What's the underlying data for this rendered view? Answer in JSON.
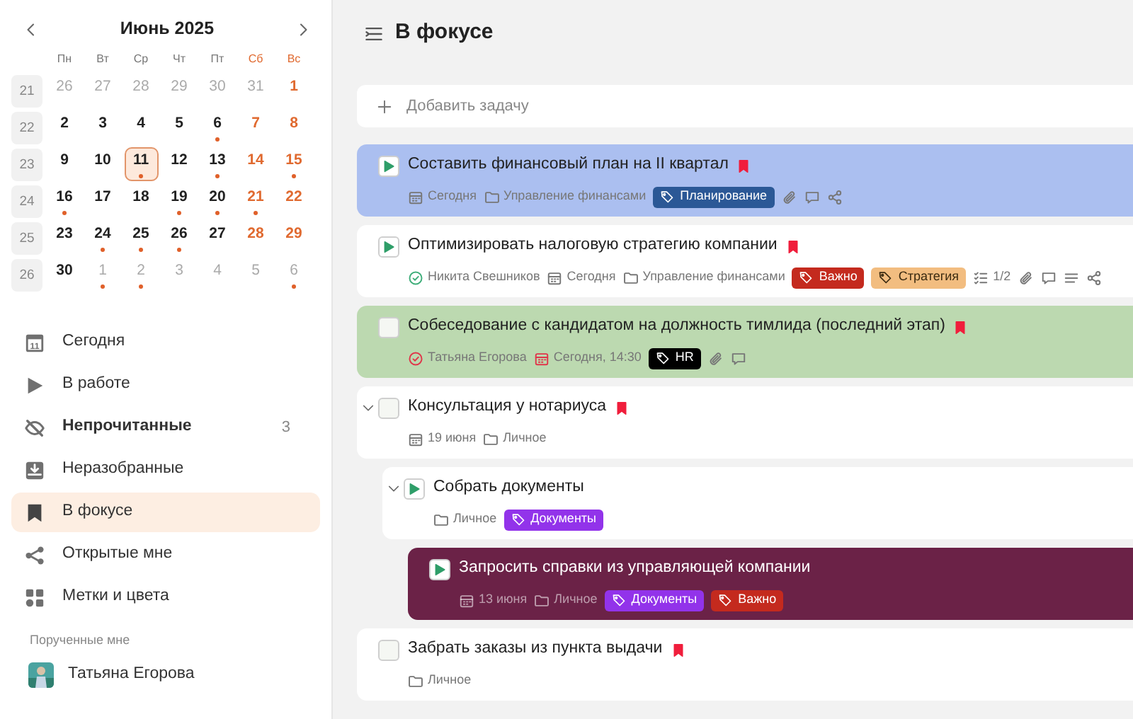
{
  "calendar": {
    "title": "Июнь 2025",
    "weekdays": [
      {
        "text": "Пн",
        "weekend": false
      },
      {
        "text": "Вт",
        "weekend": false
      },
      {
        "text": "Ср",
        "weekend": false
      },
      {
        "text": "Чт",
        "weekend": false
      },
      {
        "text": "Пт",
        "weekend": false
      },
      {
        "text": "Сб",
        "weekend": true
      },
      {
        "text": "Вс",
        "weekend": true
      }
    ],
    "weeks": [
      {
        "number": "21",
        "days": [
          {
            "text": "26",
            "kind": "other",
            "dot": false,
            "selected": false
          },
          {
            "text": "27",
            "kind": "other",
            "dot": false,
            "selected": false
          },
          {
            "text": "28",
            "kind": "other",
            "dot": false,
            "selected": false
          },
          {
            "text": "29",
            "kind": "other",
            "dot": false,
            "selected": false
          },
          {
            "text": "30",
            "kind": "other",
            "dot": false,
            "selected": false
          },
          {
            "text": "31",
            "kind": "other",
            "dot": false,
            "selected": false
          },
          {
            "text": "1",
            "kind": "weekend",
            "dot": false,
            "selected": false
          }
        ]
      },
      {
        "number": "22",
        "days": [
          {
            "text": "2",
            "kind": "day",
            "dot": false,
            "selected": false
          },
          {
            "text": "3",
            "kind": "day",
            "dot": false,
            "selected": false
          },
          {
            "text": "4",
            "kind": "day",
            "dot": false,
            "selected": false
          },
          {
            "text": "5",
            "kind": "day",
            "dot": false,
            "selected": false
          },
          {
            "text": "6",
            "kind": "day",
            "dot": true,
            "selected": false
          },
          {
            "text": "7",
            "kind": "weekend",
            "dot": false,
            "selected": false
          },
          {
            "text": "8",
            "kind": "weekend",
            "dot": false,
            "selected": false
          }
        ]
      },
      {
        "number": "23",
        "days": [
          {
            "text": "9",
            "kind": "day",
            "dot": false,
            "selected": false
          },
          {
            "text": "10",
            "kind": "day",
            "dot": false,
            "selected": false
          },
          {
            "text": "11",
            "kind": "day",
            "dot": true,
            "selected": true
          },
          {
            "text": "12",
            "kind": "day",
            "dot": false,
            "selected": false
          },
          {
            "text": "13",
            "kind": "day",
            "dot": true,
            "selected": false
          },
          {
            "text": "14",
            "kind": "weekend",
            "dot": false,
            "selected": false
          },
          {
            "text": "15",
            "kind": "weekend",
            "dot": true,
            "selected": false
          }
        ]
      },
      {
        "number": "24",
        "days": [
          {
            "text": "16",
            "kind": "day",
            "dot": true,
            "selected": false
          },
          {
            "text": "17",
            "kind": "day",
            "dot": false,
            "selected": false
          },
          {
            "text": "18",
            "kind": "day",
            "dot": false,
            "selected": false
          },
          {
            "text": "19",
            "kind": "day",
            "dot": true,
            "selected": false
          },
          {
            "text": "20",
            "kind": "day",
            "dot": true,
            "selected": false
          },
          {
            "text": "21",
            "kind": "weekend",
            "dot": true,
            "selected": false
          },
          {
            "text": "22",
            "kind": "weekend",
            "dot": false,
            "selected": false
          }
        ]
      },
      {
        "number": "25",
        "days": [
          {
            "text": "23",
            "kind": "day",
            "dot": false,
            "selected": false
          },
          {
            "text": "24",
            "kind": "day",
            "dot": true,
            "selected": false
          },
          {
            "text": "25",
            "kind": "day",
            "dot": true,
            "selected": false
          },
          {
            "text": "26",
            "kind": "day",
            "dot": true,
            "selected": false
          },
          {
            "text": "27",
            "kind": "day",
            "dot": false,
            "selected": false
          },
          {
            "text": "28",
            "kind": "weekend",
            "dot": false,
            "selected": false
          },
          {
            "text": "29",
            "kind": "weekend",
            "dot": false,
            "selected": false
          }
        ]
      },
      {
        "number": "26",
        "days": [
          {
            "text": "30",
            "kind": "day",
            "dot": false,
            "selected": false
          },
          {
            "text": "1",
            "kind": "other",
            "dot": true,
            "selected": false
          },
          {
            "text": "2",
            "kind": "other",
            "dot": true,
            "selected": false
          },
          {
            "text": "3",
            "kind": "other",
            "dot": false,
            "selected": false
          },
          {
            "text": "4",
            "kind": "other",
            "dot": false,
            "selected": false
          },
          {
            "text": "5",
            "kind": "other",
            "dot": false,
            "selected": false
          },
          {
            "text": "6",
            "kind": "other",
            "dot": true,
            "selected": false
          }
        ]
      }
    ]
  },
  "sidebar": {
    "items": [
      {
        "kind": "today",
        "icon_label": "11",
        "label": "Сегодня",
        "bold": false,
        "selected": false
      },
      {
        "kind": "progress",
        "label": "В работе",
        "bold": false,
        "selected": false
      },
      {
        "kind": "unread",
        "label": "Непрочитанные",
        "bold": true,
        "count": "3",
        "selected": false
      },
      {
        "kind": "inbox",
        "label": "Неразобранные",
        "bold": false,
        "selected": false
      },
      {
        "kind": "focus",
        "label": "В фокусе",
        "bold": false,
        "selected": true
      },
      {
        "kind": "shared",
        "label": "Открытые мне",
        "bold": false,
        "selected": false
      },
      {
        "kind": "tags",
        "label": "Метки и цвета",
        "bold": false,
        "selected": false
      }
    ],
    "section_title": "Порученные мне",
    "people": [
      {
        "name": "Татьяна Егорова"
      }
    ]
  },
  "header": {
    "title": "В фокусе"
  },
  "add_task": {
    "placeholder": "Добавить задачу"
  },
  "tasks": [
    {
      "title": "Составить финансовый план на II квартал",
      "kind": "play",
      "bookmarked": true,
      "color": "#abbff0",
      "meta": [
        {
          "kind": "date",
          "text": "Сегодня",
          "overdue": false
        },
        {
          "kind": "folder",
          "text": "Управление финансами"
        },
        {
          "kind": "tag",
          "text": "Планирование",
          "color": "#2b5896"
        },
        {
          "kind": "attachment"
        },
        {
          "kind": "comment"
        },
        {
          "kind": "share"
        }
      ]
    },
    {
      "title": "Оптимизировать налоговую стратегию компании",
      "kind": "play",
      "bookmarked": true,
      "color": "#ffffff",
      "meta": [
        {
          "kind": "assignee",
          "text": "Никита Свешников",
          "color": "#3fae7a"
        },
        {
          "kind": "date",
          "text": "Сегодня",
          "overdue": false
        },
        {
          "kind": "folder",
          "text": "Управление финансами"
        },
        {
          "kind": "tag",
          "text": "Важно",
          "color": "#c42a1e"
        },
        {
          "kind": "tag",
          "text": "Стратегия",
          "color": "#f2bd80"
        },
        {
          "kind": "subtasks",
          "text": "1/2"
        },
        {
          "kind": "attachment"
        },
        {
          "kind": "comment"
        },
        {
          "kind": "notes"
        },
        {
          "kind": "share"
        }
      ]
    },
    {
      "title": "Собеседование с кандидатом на должность тимлида (последний этап)",
      "kind": "empty",
      "bookmarked": true,
      "color": "#bcd9b0",
      "meta": [
        {
          "kind": "assignee",
          "text": "Татьяна Егорова",
          "color": "#e0364a"
        },
        {
          "kind": "date",
          "text": "Сегодня, 14:30",
          "overdue": true
        },
        {
          "kind": "tag",
          "text": "HR",
          "color": "#000000"
        },
        {
          "kind": "attachment"
        },
        {
          "kind": "comment"
        }
      ]
    },
    {
      "title": "Консультация у нотариуса",
      "kind": "empty",
      "bookmarked": true,
      "color": "#ffffff",
      "expanded": true,
      "meta": [
        {
          "kind": "date",
          "text": "19 июня",
          "overdue": false
        },
        {
          "kind": "folder",
          "text": "Личное"
        }
      ],
      "children": [
        {
          "title": "Собрать документы",
          "kind": "play",
          "bookmarked": false,
          "color": "#ffffff",
          "expanded": true,
          "meta": [
            {
              "kind": "folder",
              "text": "Личное"
            },
            {
              "kind": "tag",
              "text": "Документы",
              "color": "#9233ea"
            }
          ],
          "children": [
            {
              "title": "Запросить справки из управляющей компании",
              "kind": "play",
              "bookmarked": false,
              "color": "#6b2247",
              "meta": [
                {
                  "kind": "date",
                  "text": "13 июня",
                  "overdue": false
                },
                {
                  "kind": "folder",
                  "text": "Личное"
                },
                {
                  "kind": "tag",
                  "text": "Документы",
                  "color": "#9233ea"
                },
                {
                  "kind": "tag",
                  "text": "Важно",
                  "color": "#c42a1e"
                }
              ]
            }
          ]
        }
      ]
    },
    {
      "title": "Забрать заказы из пункта выдачи",
      "kind": "empty",
      "bookmarked": true,
      "color": "#ffffff",
      "meta": [
        {
          "kind": "folder",
          "text": "Личное"
        }
      ]
    }
  ]
}
